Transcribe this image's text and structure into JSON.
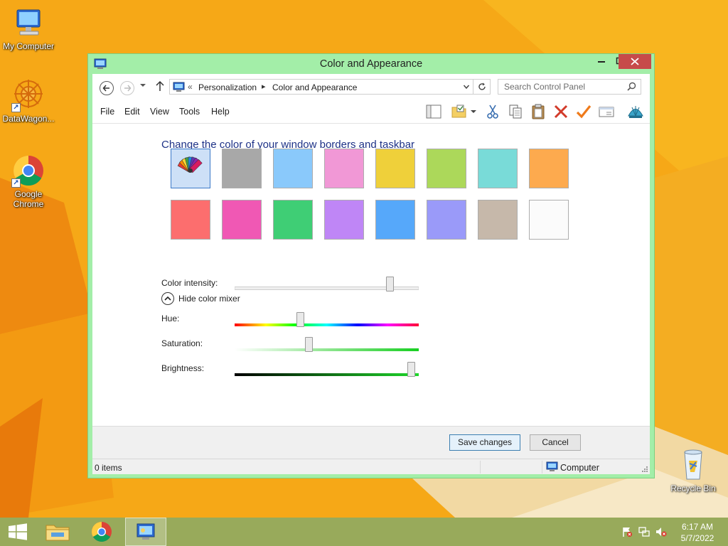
{
  "desktop": {
    "icons": [
      {
        "label": "My Computer",
        "icon": "computer-icon"
      },
      {
        "label": "DataWagon...",
        "icon": "datawagon-icon"
      },
      {
        "label": "Google\nChrome",
        "label_line1": "Google",
        "label_line2": "Chrome",
        "icon": "chrome-icon"
      },
      {
        "label": "Recycle Bin",
        "icon": "recycle-bin-icon"
      }
    ]
  },
  "window": {
    "title": "Color and Appearance",
    "controls": {
      "minimize": "—",
      "maximize": "□",
      "close": "✕"
    }
  },
  "address_bar": {
    "chevron": "«",
    "breadcrumbs": [
      "Personalization",
      "Color and Appearance"
    ],
    "separator": "▸",
    "search_placeholder": "Search Control Panel"
  },
  "menu": {
    "items": [
      "File",
      "Edit",
      "View",
      "Tools",
      "Help"
    ],
    "toolbar_icons": [
      "layout-pane-icon",
      "folder-options-icon",
      "dropdown-icon",
      "cut-icon",
      "copy-icon",
      "paste-icon",
      "delete-icon",
      "checkmark-icon",
      "properties-icon",
      "shell-icon"
    ]
  },
  "content": {
    "heading": "Change the color of your window borders and taskbar",
    "swatches": [
      {
        "name": "automatic",
        "color": "palette"
      },
      {
        "name": "gray",
        "color": "#a8a8a8"
      },
      {
        "name": "light-blue",
        "color": "#8ac9fb"
      },
      {
        "name": "pink",
        "color": "#f198d6"
      },
      {
        "name": "yellow",
        "color": "#efd03a"
      },
      {
        "name": "lime",
        "color": "#acd85a"
      },
      {
        "name": "teal",
        "color": "#79dbd8"
      },
      {
        "name": "orange",
        "color": "#fdaa4e"
      },
      {
        "name": "red",
        "color": "#fc6e6e"
      },
      {
        "name": "magenta",
        "color": "#f058b4"
      },
      {
        "name": "green",
        "color": "#3fce75"
      },
      {
        "name": "purple",
        "color": "#bf86f6"
      },
      {
        "name": "blue",
        "color": "#56a8fa"
      },
      {
        "name": "periwinkle",
        "color": "#9a9af9"
      },
      {
        "name": "taupe",
        "color": "#c6b8aa"
      },
      {
        "name": "white",
        "color": "#fbfbfb"
      }
    ],
    "selected_swatch": 0,
    "color_intensity": {
      "label": "Color intensity:",
      "value": 0.86
    },
    "mixer_toggle_label": "Hide color mixer",
    "hue": {
      "label": "Hue:",
      "value": 0.35
    },
    "saturation": {
      "label": "Saturation:",
      "value": 0.4
    },
    "brightness": {
      "label": "Brightness:",
      "value": 0.98
    }
  },
  "buttons": {
    "save": "Save changes",
    "cancel": "Cancel"
  },
  "status_bar": {
    "items": "0 items",
    "location": "Computer"
  },
  "taskbar": {
    "apps": [
      "start-icon",
      "file-explorer-icon",
      "chrome-icon",
      "control-panel-icon"
    ],
    "tray": [
      "action-center-icon",
      "network-icon",
      "volume-muted-icon"
    ],
    "clock": {
      "time": "6:17 AM",
      "date": "5/7/2022"
    }
  },
  "colors": {
    "window_frame": "#a3eea8",
    "title_accent": "#1e3287",
    "close_button": "#c74a4a",
    "desktop": "#f7a816"
  }
}
